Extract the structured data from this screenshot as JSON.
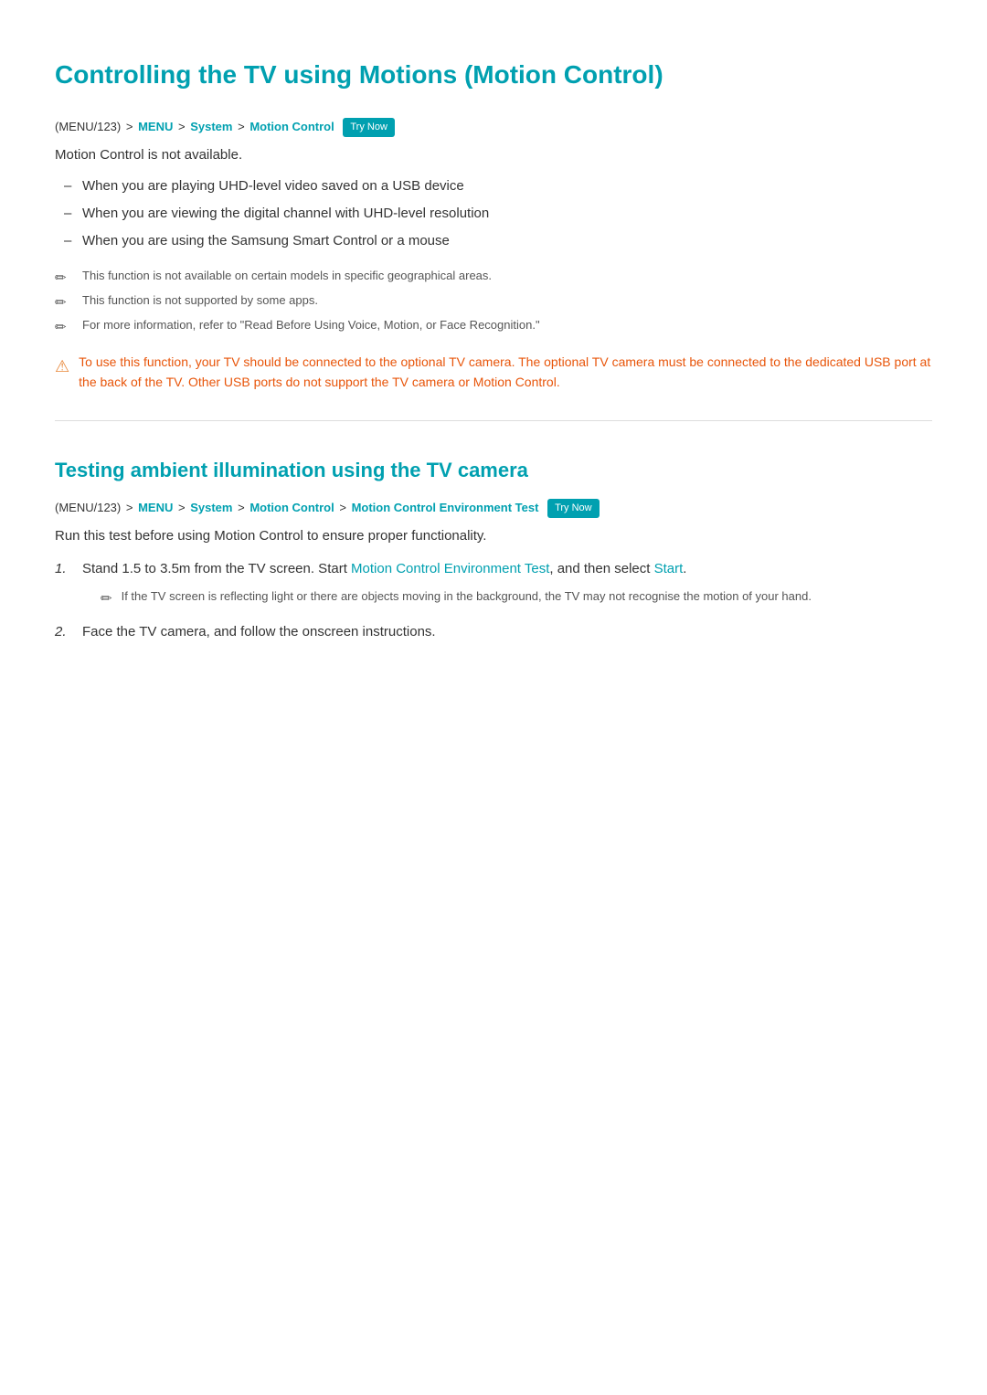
{
  "page": {
    "main_title": "Controlling the TV using Motions (Motion Control)",
    "section1": {
      "breadcrumb": {
        "part1": "(MENU/123)",
        "arrow1": ">",
        "part2": "MENU",
        "arrow2": ">",
        "part3": "System",
        "arrow3": ">",
        "part4": "Motion Control",
        "badge": "Try Now"
      },
      "intro": "Motion Control is not available.",
      "bullets": [
        "When you are playing UHD-level video saved on a USB device",
        "When you are viewing the digital channel with UHD-level resolution",
        "When you are using the Samsung Smart Control or a mouse"
      ],
      "notes": [
        "This function is not available on certain models in specific geographical areas.",
        "This function is not supported by some apps.",
        "For more information, refer to \"Read Before Using Voice, Motion, or Face Recognition.\""
      ],
      "warning": "To use this function, your TV should be connected to the optional TV camera. The optional TV camera must be connected to the dedicated USB port at the back of the TV. Other USB ports do not support the TV camera or Motion Control."
    },
    "section2": {
      "title": "Testing ambient illumination using the TV camera",
      "breadcrumb": {
        "part1": "(MENU/123)",
        "arrow1": ">",
        "part2": "MENU",
        "arrow2": ">",
        "part3": "System",
        "arrow3": ">",
        "part4": "Motion Control",
        "arrow4": ">",
        "part5": "Motion Control Environment Test",
        "badge": "Try Now"
      },
      "run_note": "Run this test before using Motion Control to ensure proper functionality.",
      "steps": [
        {
          "number": "1.",
          "text_before": "Stand 1.5 to 3.5m from the TV screen. Start ",
          "link": "Motion Control Environment Test",
          "text_after": ", and then select ",
          "link2": "Start",
          "text_end": ".",
          "sub_note": "If the TV screen is reflecting light or there are objects moving in the background, the TV may not recognise the motion of your hand."
        },
        {
          "number": "2.",
          "text": "Face the TV camera, and follow the onscreen instructions."
        }
      ]
    }
  }
}
